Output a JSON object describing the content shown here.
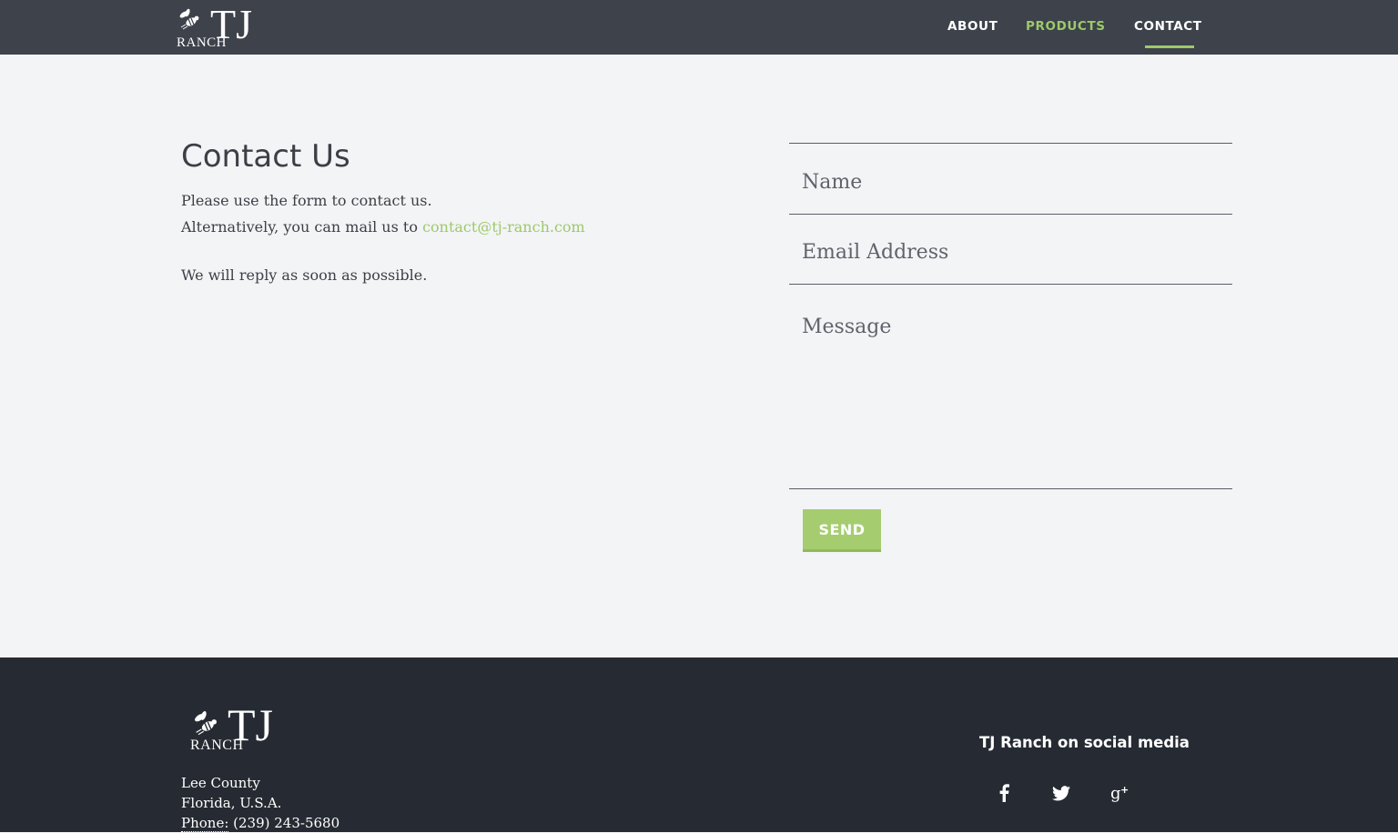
{
  "header": {
    "logo": {
      "tj": "TJ",
      "ranch": "RANCH"
    },
    "nav": [
      {
        "label": "ABOUT"
      },
      {
        "label": "PRODUCTS"
      },
      {
        "label": "CONTACT"
      }
    ],
    "active_nav": "CONTACT"
  },
  "main": {
    "title": "Contact Us",
    "intro_line1": "Please use the form to contact us.",
    "intro_line2_prefix": "Alternatively, you can mail us to ",
    "email_link": "contact@tj-ranch.com",
    "reply_text": "We will reply as soon as possible."
  },
  "form": {
    "name_placeholder": "Name",
    "email_placeholder": "Email Address",
    "message_placeholder": "Message",
    "send_label": "SEND"
  },
  "footer": {
    "logo": {
      "tj": "TJ",
      "ranch": "RANCH"
    },
    "address_line1": "Lee County",
    "address_line2": "Florida, U.S.A.",
    "phone_label": "Phone:",
    "phone_number": " (239) 243-5680",
    "social_title": "TJ Ranch on social media",
    "social_icons": [
      "facebook-icon",
      "twitter-icon",
      "google-plus-icon"
    ]
  },
  "colors": {
    "header_bg": "#3d424b",
    "page_bg": "#f3f4f6",
    "footer_bg": "#262b33",
    "accent": "#9dc96a",
    "text": "#3c3f46"
  }
}
